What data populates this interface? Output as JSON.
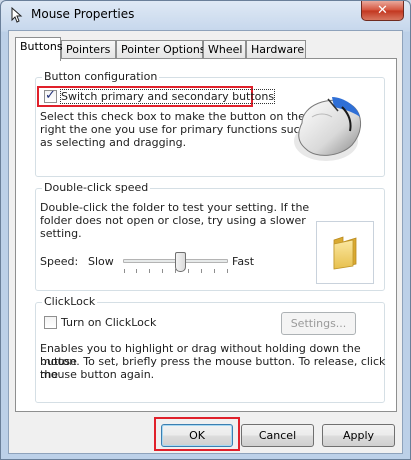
{
  "window": {
    "title": "Mouse Properties",
    "close_glyph": "✕"
  },
  "tabs": [
    {
      "label": "Buttons",
      "active": true
    },
    {
      "label": "Pointers",
      "active": false
    },
    {
      "label": "Pointer Options",
      "active": false
    },
    {
      "label": "Wheel",
      "active": false
    },
    {
      "label": "Hardware",
      "active": false
    }
  ],
  "button_configuration": {
    "title": "Button configuration",
    "checkbox_label": "Switch primary and secondary buttons",
    "checked": true,
    "description_lines": [
      "Select this check box to make the button on the",
      "right the one you use for primary functions such",
      "as selecting and dragging."
    ]
  },
  "double_click": {
    "title": "Double-click speed",
    "description_lines": [
      "Double-click the folder to test your setting. If the",
      "folder does not open or close, try using a slower",
      "setting."
    ],
    "speed_label": "Speed:",
    "slow_label": "Slow",
    "fast_label": "Fast",
    "speed_level": 0.5
  },
  "clicklock": {
    "title": "ClickLock",
    "checkbox_label": "Turn on ClickLock",
    "checked": false,
    "settings_button": "Settings...",
    "description_lines": [
      "Enables you to highlight or drag without holding down the mouse",
      "button. To set, briefly press the mouse button. To release, click the",
      "mouse button again."
    ]
  },
  "footer": {
    "ok": "OK",
    "cancel": "Cancel",
    "apply": "Apply"
  },
  "colors": {
    "highlight": "#e0202a",
    "mouse_accent": "#2f6fd6"
  },
  "icons": {
    "title": "mouse-pointer-icon",
    "mouse": "mouse-illustration-icon",
    "folder": "folder-icon"
  }
}
